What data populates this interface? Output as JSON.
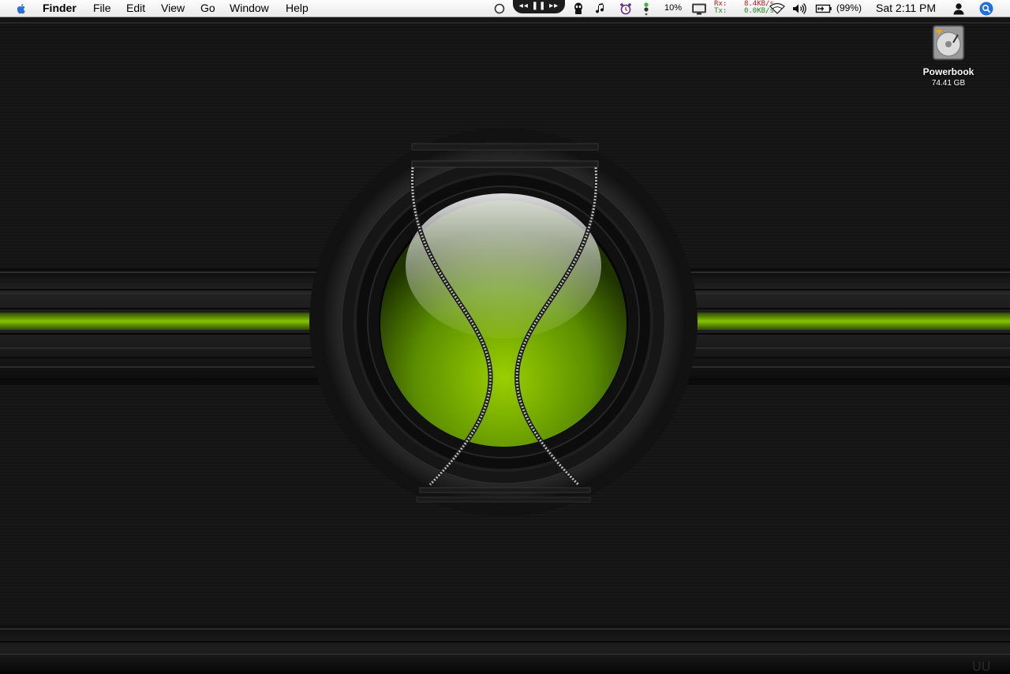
{
  "menubar": {
    "app_name": "Finder",
    "menus": [
      "File",
      "Edit",
      "View",
      "Go",
      "Window",
      "Help"
    ],
    "media_controls": "◂◂ ❚❚ ▸▸",
    "cpu": "10%",
    "network": {
      "rx_label": "Rx:",
      "rx_value": "8.4KB/s",
      "tx_label": "Tx:",
      "tx_value": "0.0KB/s"
    },
    "battery": "(99%)",
    "clock": "Sat 2:11 PM",
    "icons": [
      "apple-icon",
      "spinner-icon",
      "alien-icon",
      "music-note-icon",
      "alarm-clock-icon",
      "status-dots-icon",
      "display-icon",
      "wifi-icon",
      "volume-icon",
      "battery-icon",
      "user-icon",
      "spotlight-icon"
    ]
  },
  "desktop": {
    "items": [
      {
        "name": "Powerbook",
        "size": "74.41 GB",
        "icon": "hard-drive-icon"
      }
    ]
  },
  "colors": {
    "accent": "#7fbf00",
    "background": "#141414",
    "menubar": "#f0f0f0"
  }
}
